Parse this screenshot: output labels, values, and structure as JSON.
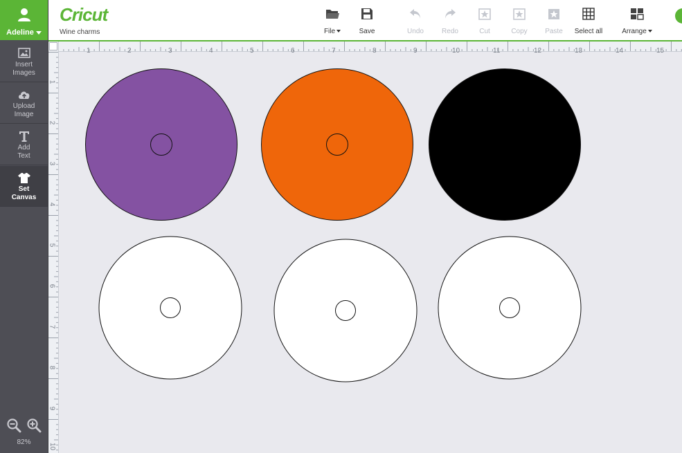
{
  "user": {
    "name": "Adeline"
  },
  "sidebar": {
    "items": [
      {
        "id": "insert-images",
        "label": [
          "Insert",
          "Images"
        ],
        "icon": "image-icon"
      },
      {
        "id": "upload-image",
        "label": [
          "Upload",
          "Image"
        ],
        "icon": "cloud-upload-icon"
      },
      {
        "id": "add-text",
        "label": [
          "Add",
          "Text"
        ],
        "icon": "text-t-icon"
      },
      {
        "id": "set-canvas",
        "label": [
          "Set",
          "Canvas"
        ],
        "icon": "tshirt-icon",
        "active": true
      }
    ],
    "zoom_level": "82%"
  },
  "header": {
    "logo": "Cricut",
    "project_name": "Wine charms",
    "tools": [
      {
        "id": "file",
        "label": "File",
        "icon": "folder-icon",
        "dropdown": true,
        "enabled": true
      },
      {
        "id": "save",
        "label": "Save",
        "icon": "floppy-disk-icon",
        "enabled": true
      },
      {
        "id": "undo",
        "label": "Undo",
        "icon": "undo-arrow-icon",
        "enabled": false
      },
      {
        "id": "redo",
        "label": "Redo",
        "icon": "redo-arrow-icon",
        "enabled": false
      },
      {
        "id": "cut",
        "label": "Cut",
        "icon": "cut-icon",
        "enabled": false
      },
      {
        "id": "copy",
        "label": "Copy",
        "icon": "copy-icon",
        "enabled": false
      },
      {
        "id": "paste",
        "label": "Paste",
        "icon": "paste-icon",
        "enabled": false
      },
      {
        "id": "select-all",
        "label": "Select all",
        "icon": "grid-icon",
        "enabled": true
      },
      {
        "id": "arrange",
        "label": "Arrange",
        "icon": "arrange-icon",
        "dropdown": true,
        "enabled": true
      }
    ]
  },
  "rulers": {
    "top": [
      "1",
      "2",
      "3",
      "4",
      "5",
      "6",
      "7",
      "8",
      "9",
      "10",
      "11",
      "12",
      "13",
      "14",
      "15"
    ],
    "left": [
      "1",
      "2",
      "3",
      "4",
      "5",
      "6",
      "7",
      "8",
      "9",
      "10"
    ]
  },
  "canvas": {
    "charms": [
      {
        "id": "charm-1",
        "fill": "#8452a2"
      },
      {
        "id": "charm-2",
        "fill": "#ef660a"
      },
      {
        "id": "charm-3",
        "fill": "#000000"
      },
      {
        "id": "charm-4",
        "fill": "#ffffff"
      },
      {
        "id": "charm-5",
        "fill": "#ffffff"
      },
      {
        "id": "charm-6",
        "fill": "#ffffff"
      }
    ]
  },
  "colors": {
    "brand": "#5bb536",
    "sidebar": "#4e4e55",
    "canvas_bg": "#e9e9ee"
  }
}
